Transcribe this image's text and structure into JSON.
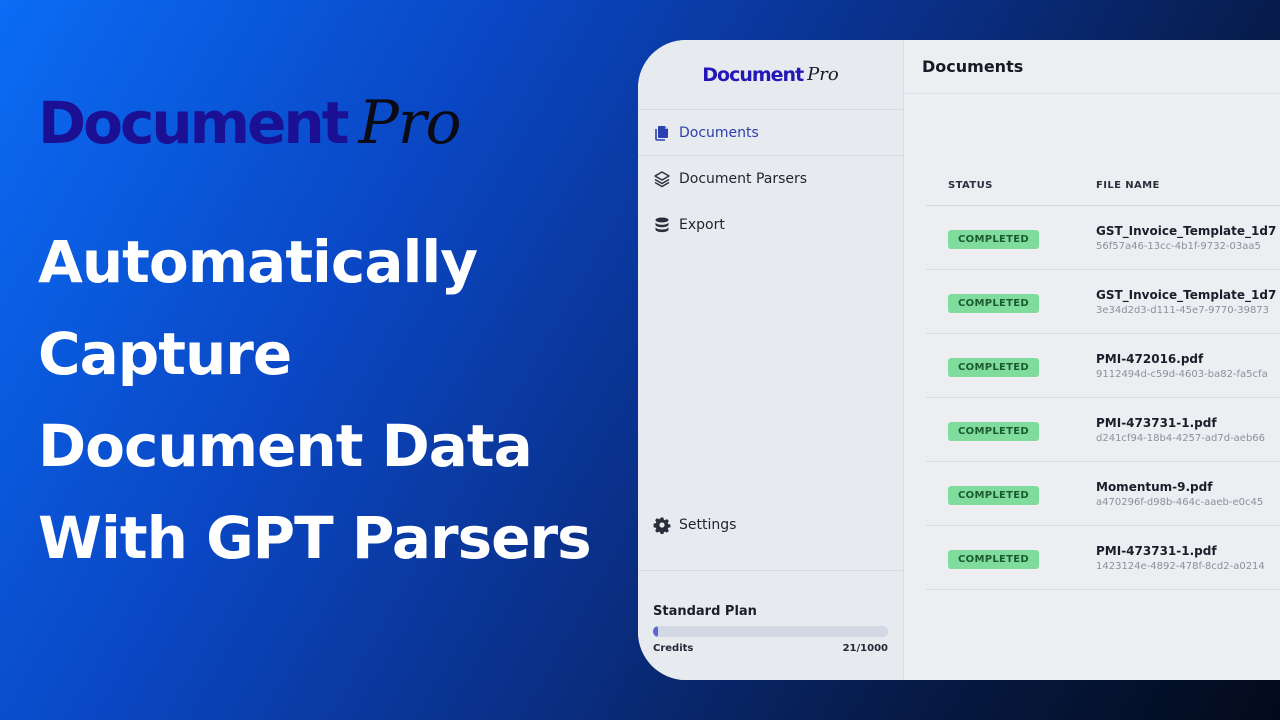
{
  "hero": {
    "logo_word": "Document",
    "logo_pro": "Pro",
    "headline": [
      "Automatically",
      "Capture",
      "Document Data",
      "With GPT Parsers"
    ]
  },
  "app": {
    "logo_word": "Document",
    "logo_pro": "Pro",
    "nav": [
      {
        "label": "Documents",
        "icon": "documents-icon",
        "active": true
      },
      {
        "label": "Document Parsers",
        "icon": "layers-icon",
        "active": false
      },
      {
        "label": "Export",
        "icon": "database-icon",
        "active": false
      }
    ],
    "settings_label": "Settings",
    "plan": {
      "title": "Standard Plan",
      "credits_label": "Credits",
      "credits_value": "21/1000",
      "credits_fraction": 0.021
    },
    "page_title": "Documents",
    "table": {
      "headers": {
        "status": "STATUS",
        "file_name": "FILE NAME"
      },
      "rows": [
        {
          "status": "COMPLETED",
          "name": "GST_Invoice_Template_1d7",
          "id": "56f57a46-13cc-4b1f-9732-03aa5"
        },
        {
          "status": "COMPLETED",
          "name": "GST_Invoice_Template_1d7",
          "id": "3e34d2d3-d111-45e7-9770-39873"
        },
        {
          "status": "COMPLETED",
          "name": "PMI-472016.pdf",
          "id": "9112494d-c59d-4603-ba82-fa5cfa"
        },
        {
          "status": "COMPLETED",
          "name": "PMI-473731-1.pdf",
          "id": "d241cf94-18b4-4257-ad7d-aeb66"
        },
        {
          "status": "COMPLETED",
          "name": "Momentum-9.pdf",
          "id": "a470296f-d98b-464c-aaeb-e0c45"
        },
        {
          "status": "COMPLETED",
          "name": "PMI-473731-1.pdf",
          "id": "1423124e-4892-478f-8cd2-a0214"
        }
      ]
    },
    "colors": {
      "accent": "#2b3fae",
      "badge_bg": "#7fdc9c",
      "progress_fill": "#5b66d6"
    }
  }
}
